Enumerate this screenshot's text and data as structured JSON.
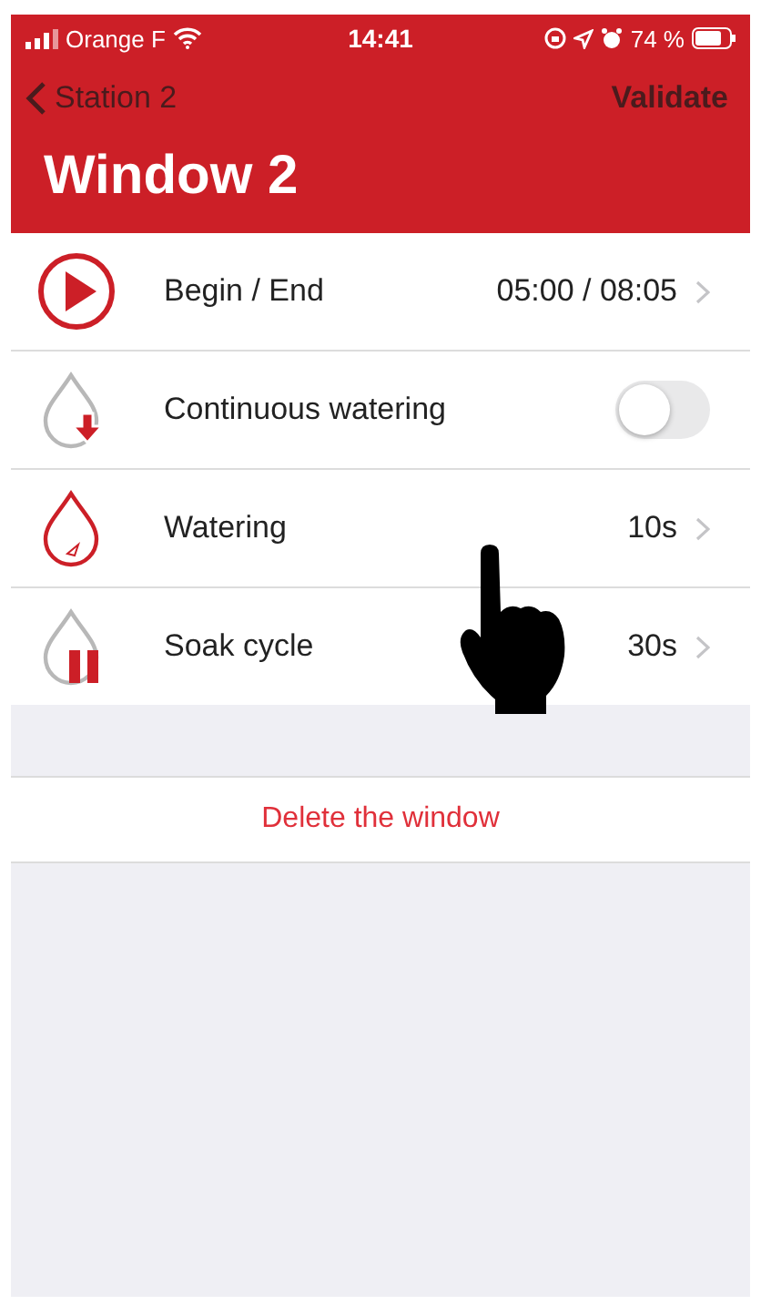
{
  "status_bar": {
    "carrier": "Orange F",
    "time": "14:41",
    "battery": "74 %"
  },
  "nav": {
    "back": "Station 2",
    "action": "Validate"
  },
  "title": "Window 2",
  "rows": [
    {
      "kind": "value",
      "label": "Begin / End",
      "value": "05:00 / 08:05"
    },
    {
      "kind": "toggle",
      "label": "Continuous watering",
      "on": false
    },
    {
      "kind": "value",
      "label": "Watering",
      "value": "10s"
    },
    {
      "kind": "value",
      "label": "Soak cycle",
      "value": "30s"
    }
  ],
  "delete": "Delete the window"
}
